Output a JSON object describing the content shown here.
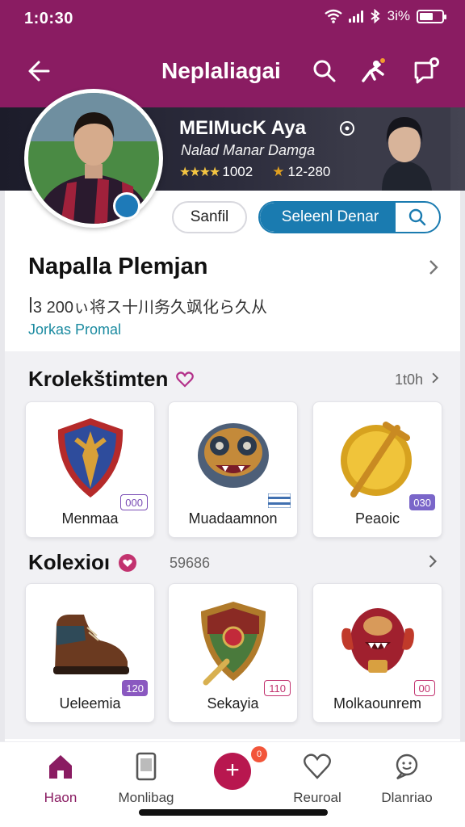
{
  "status": {
    "time": "1:0:30",
    "battery_text": "3i%"
  },
  "header": {
    "title": "Neplaliagai"
  },
  "banner": {
    "player_name": "MEIMuсK Aya",
    "subtitle": "Nalad Manar Damga",
    "stat1": "1002",
    "stat2": "12-280"
  },
  "actions": {
    "chip_label": "Sanfil",
    "search_label": "Seleenl Denar"
  },
  "profile": {
    "title": "Napalla Plemjan",
    "description": "ꟾ3 200ぃ将ス十川务久飒化ら久从",
    "link": "Jorkas Promal"
  },
  "collection1": {
    "title": "Krolekštimten",
    "count": "1t0h",
    "items": [
      {
        "name": "Menmaa",
        "tag": "000"
      },
      {
        "name": "Muadaamnon",
        "tag": ""
      },
      {
        "name": "Peaoic",
        "tag": "030"
      }
    ]
  },
  "collection2": {
    "title": "Kolexioı",
    "count": "59686",
    "items": [
      {
        "name": "Ueleemia",
        "tag": "120"
      },
      {
        "name": "Sekayia",
        "tag": "110"
      },
      {
        "name": "Molkaounrem",
        "tag": "00"
      }
    ]
  },
  "bottom_nav": {
    "items": [
      {
        "label": "Haon"
      },
      {
        "label": "Monlibag"
      },
      {
        "label": "Reuroal"
      },
      {
        "label": "Dlanriao"
      }
    ],
    "fab_badge": "0"
  },
  "colors": {
    "brand": "#8a1c62",
    "accent": "#1a7bb0",
    "fab": "#b8174f"
  }
}
